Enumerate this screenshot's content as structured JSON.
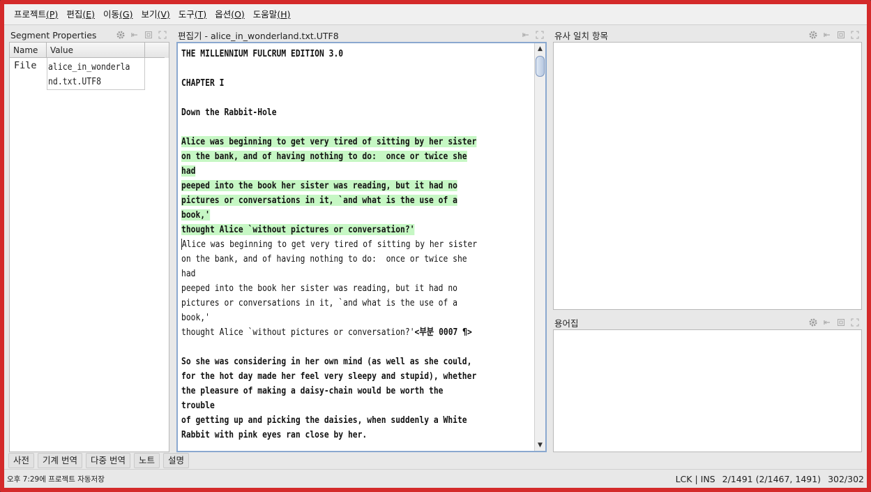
{
  "menu": [
    {
      "label": "프로젝트",
      "key": "(P)"
    },
    {
      "label": "편집",
      "key": "(E)"
    },
    {
      "label": "이동",
      "key": "(G)"
    },
    {
      "label": "보기",
      "key": "(V)"
    },
    {
      "label": "도구",
      "key": "(T)"
    },
    {
      "label": "옵션",
      "key": "(O)"
    },
    {
      "label": "도움말",
      "key": "(H)"
    }
  ],
  "segment_properties": {
    "title": "Segment Properties",
    "col_name": "Name",
    "col_value": "Value",
    "row_name": "File",
    "row_value_line1": "alice_in_wonderla",
    "row_value_line2": "nd.txt.UTF8"
  },
  "editor": {
    "title": "편집기 - alice_in_wonderland.txt.UTF8",
    "line1": "THE MILLENNIUM FULCRUM EDITION 3.0",
    "line2": "CHAPTER I",
    "line3": "Down the Rabbit-Hole",
    "active_source": [
      "Alice was beginning to get very tired of sitting by her sister",
      "on the bank, and of having nothing to do:  once or twice she",
      "had",
      "peeped into the book her sister was reading, but it had no",
      "pictures or conversations in it, `and what is the use of a",
      "book,'",
      "thought Alice `without pictures or conversation?'"
    ],
    "active_target": [
      "Alice was beginning to get very tired of sitting by her sister",
      "on the bank, and of having nothing to do:  once or twice she",
      "had",
      "peeped into the book her sister was reading, but it had no",
      "pictures or conversations in it, `and what is the use of a",
      "book,'",
      "thought Alice `without pictures or conversation?'"
    ],
    "segment_marker": "<부분 0007 ¶>",
    "next_source": [
      "So she was considering in her own mind (as well as she could,",
      "for the hot day made her feel very sleepy and stupid), whether",
      "the pleasure of making a daisy-chain would be worth the",
      "trouble",
      "of getting up and picking the daisies, when suddenly a White",
      "Rabbit with pink eyes ran close by her."
    ]
  },
  "fuzzy_matches": {
    "title": "유사 일치 항목"
  },
  "glossary": {
    "title": "용어집"
  },
  "bottom_tabs": [
    "사전",
    "기계 번역",
    "다중 번역",
    "노트",
    "설명"
  ],
  "status": {
    "left": "오후 7:29에 프로젝트 자동저장",
    "mode": "LCK | INS",
    "progress": "2/1491 (2/1467, 1491)",
    "chars": "302/302"
  },
  "colors": {
    "frame_border": "#d42a2a",
    "active_segment_bg": "#c6f7c4",
    "editor_focus_border": "#8aa8cf"
  },
  "icons": [
    "gear-icon",
    "minimize-icon",
    "restore-icon",
    "maximize-icon",
    "scroll-up-icon",
    "scroll-down-icon"
  ]
}
